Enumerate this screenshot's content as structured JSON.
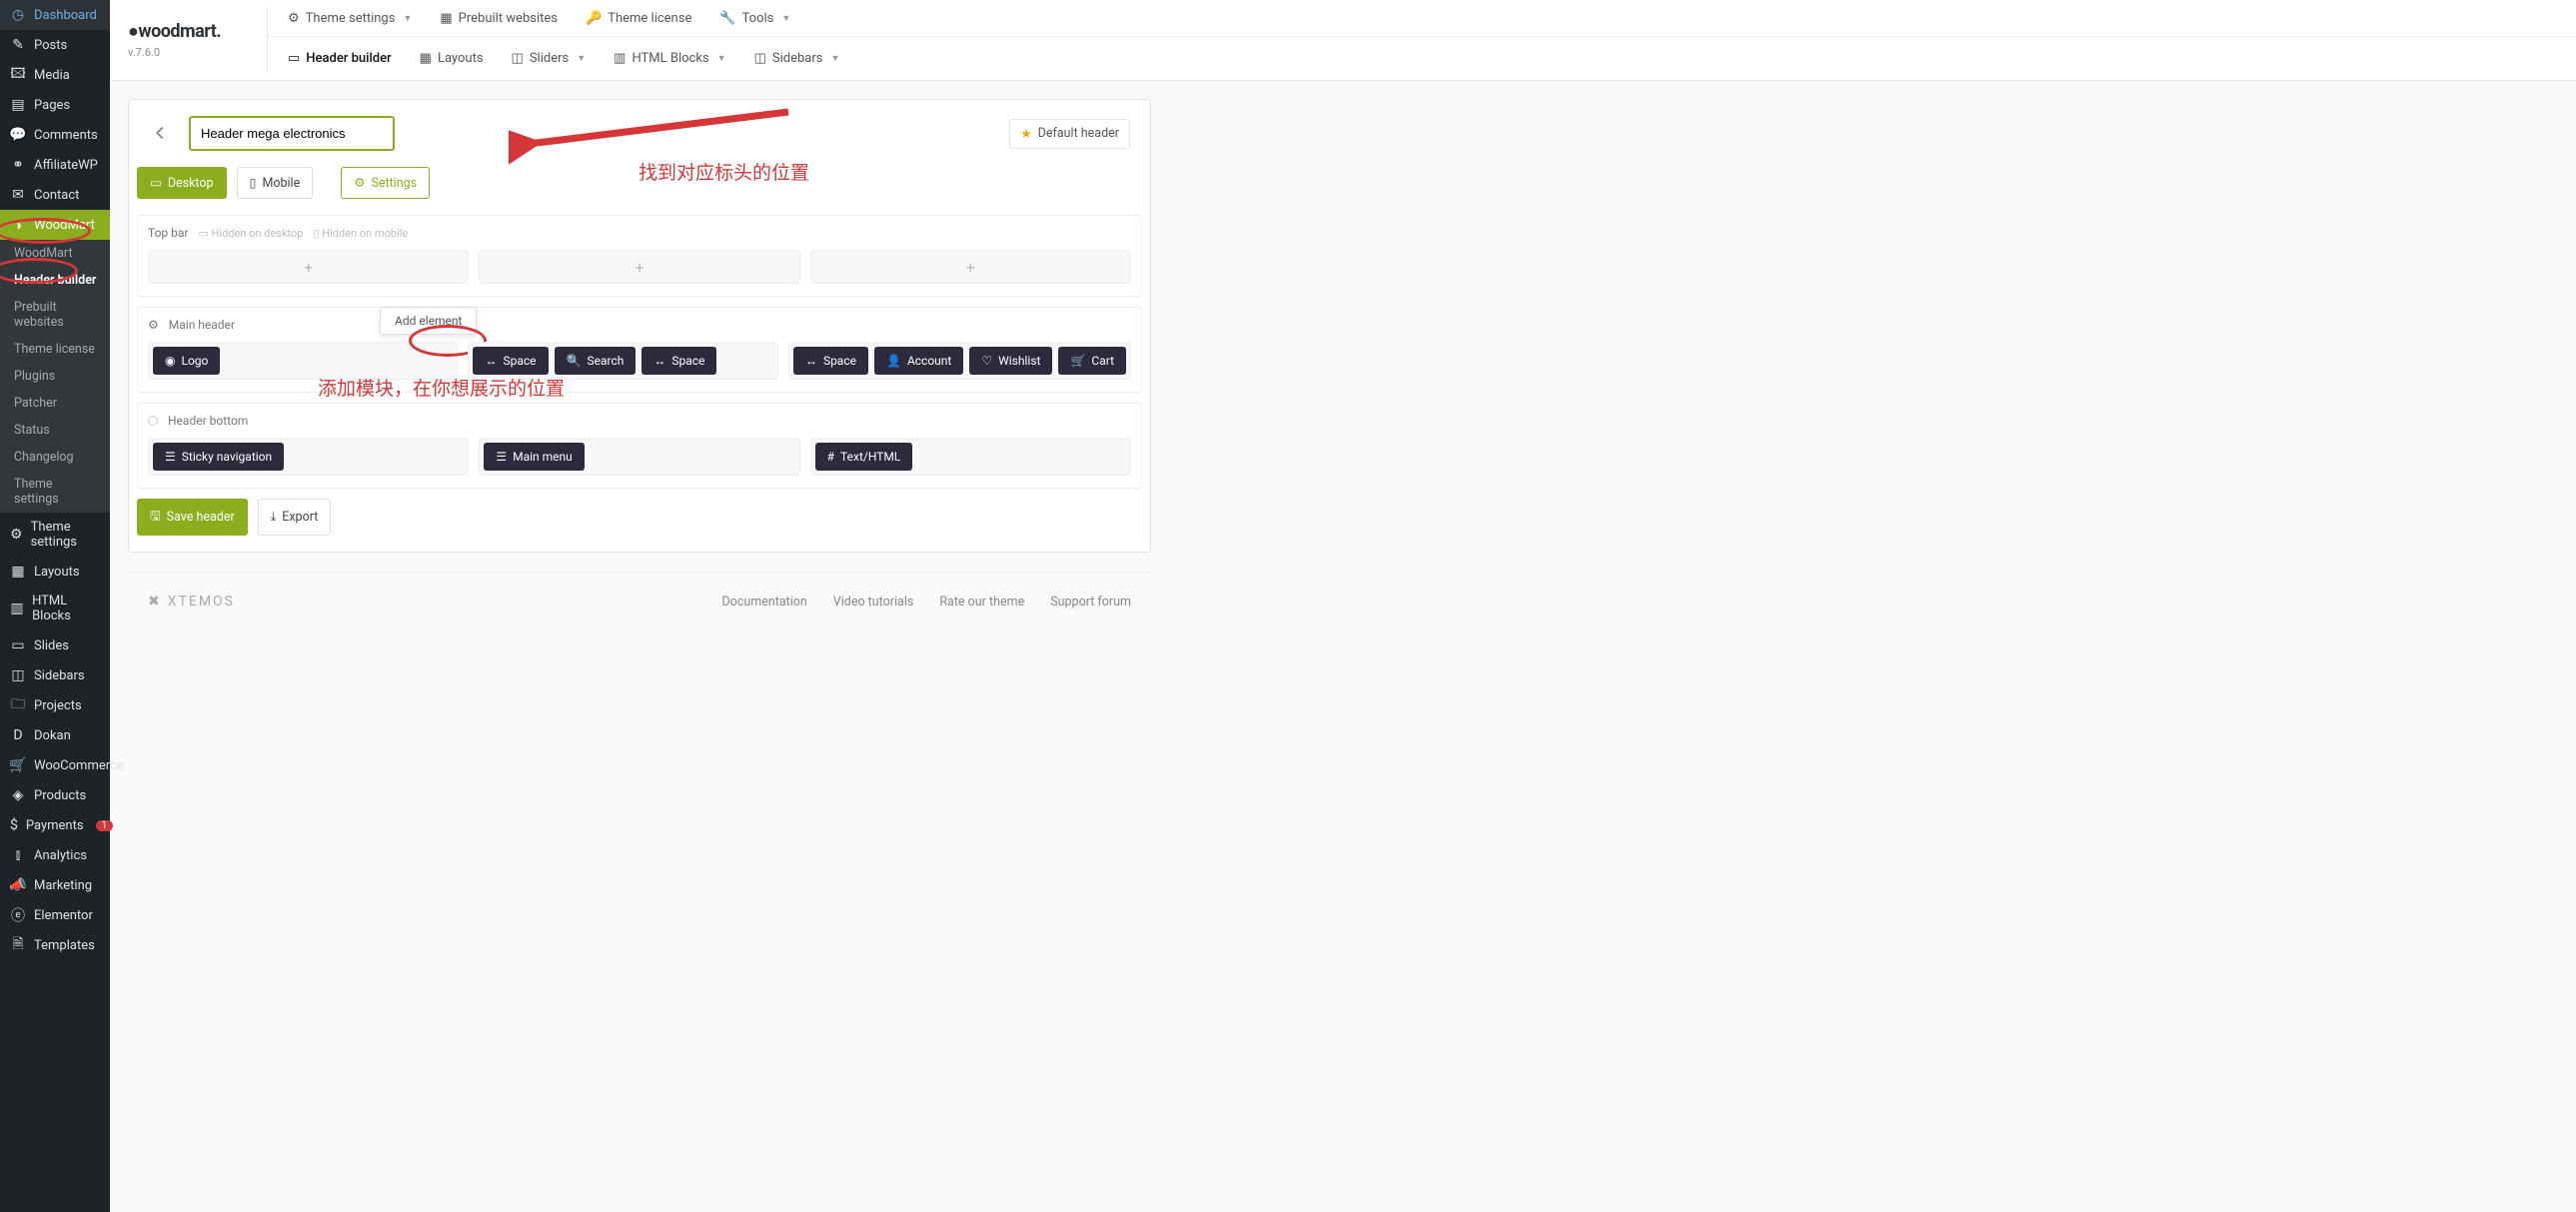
{
  "brand": {
    "name": "woodmart.",
    "version": "v.7.6.0"
  },
  "sidebar": {
    "items": [
      {
        "icon": "◷",
        "label": "Dashboard"
      },
      {
        "icon": "✎",
        "label": "Posts"
      },
      {
        "icon": "🖾",
        "label": "Media"
      },
      {
        "icon": "▤",
        "label": "Pages"
      },
      {
        "icon": "💬",
        "label": "Comments"
      },
      {
        "icon": "⚭",
        "label": "AffiliateWP"
      },
      {
        "icon": "✉",
        "label": "Contact"
      },
      {
        "icon": "◑",
        "label": "WoodMart",
        "active": true
      }
    ],
    "subitems": [
      {
        "label": "WoodMart"
      },
      {
        "label": "Header builder",
        "active": true
      },
      {
        "label": "Prebuilt websites"
      },
      {
        "label": "Theme license"
      },
      {
        "label": "Plugins"
      },
      {
        "label": "Patcher"
      },
      {
        "label": "Status"
      },
      {
        "label": "Changelog"
      },
      {
        "label": "Theme settings"
      }
    ],
    "items2": [
      {
        "icon": "⚙",
        "label": "Theme settings"
      },
      {
        "icon": "▦",
        "label": "Layouts"
      },
      {
        "icon": "▥",
        "label": "HTML Blocks"
      },
      {
        "icon": "▭",
        "label": "Slides"
      },
      {
        "icon": "◫",
        "label": "Sidebars"
      },
      {
        "icon": "🗀",
        "label": "Projects"
      },
      {
        "icon": "D",
        "label": "Dokan"
      },
      {
        "icon": "🛒",
        "label": "WooCommerce"
      },
      {
        "icon": "◈",
        "label": "Products"
      },
      {
        "icon": "$",
        "label": "Payments",
        "badge": "1"
      },
      {
        "icon": "⫾",
        "label": "Analytics"
      },
      {
        "icon": "📣",
        "label": "Marketing"
      },
      {
        "icon": "ⓔ",
        "label": "Elementor"
      },
      {
        "icon": "🗎",
        "label": "Templates"
      }
    ]
  },
  "topnav": [
    {
      "icon": "⚙",
      "label": "Theme settings",
      "chev": true
    },
    {
      "icon": "▦",
      "label": "Prebuilt websites"
    },
    {
      "icon": "🔑",
      "label": "Theme license"
    },
    {
      "icon": "🔧",
      "label": "Tools",
      "chev": true
    }
  ],
  "subnav": [
    {
      "icon": "▭",
      "label": "Header builder",
      "active": true
    },
    {
      "icon": "▦",
      "label": "Layouts"
    },
    {
      "icon": "◫",
      "label": "Sliders",
      "chev": true
    },
    {
      "icon": "▥",
      "label": "HTML Blocks",
      "chev": true
    },
    {
      "icon": "◫",
      "label": "Sidebars",
      "chev": true
    }
  ],
  "header": {
    "title_input": "Header mega electronics",
    "default_label": "Default header"
  },
  "viewbar": {
    "desktop": "Desktop",
    "mobile": "Mobile",
    "settings": "Settings"
  },
  "rows": {
    "topbar": {
      "label": "Top bar",
      "tags": [
        "Hidden on desktop",
        "Hidden on mobile"
      ]
    },
    "main": {
      "label": "Main header",
      "tooltip": "Add element",
      "col1": [
        {
          "icon": "◉",
          "label": "Logo"
        }
      ],
      "col2": [
        {
          "icon": "↔",
          "label": "Space"
        },
        {
          "icon": "🔍",
          "label": "Search"
        },
        {
          "icon": "↔",
          "label": "Space"
        }
      ],
      "col3": [
        {
          "icon": "↔",
          "label": "Space"
        },
        {
          "icon": "👤",
          "label": "Account"
        },
        {
          "icon": "♡",
          "label": "Wishlist"
        },
        {
          "icon": "🛒",
          "label": "Cart"
        }
      ]
    },
    "bottom": {
      "label": "Header bottom",
      "col1": [
        {
          "icon": "☰",
          "label": "Sticky navigation"
        }
      ],
      "col2": [
        {
          "icon": "☰",
          "label": "Main menu"
        }
      ],
      "col3": [
        {
          "icon": "#",
          "label": "Text/HTML"
        }
      ]
    }
  },
  "actions": {
    "save": "Save header",
    "export": "Export"
  },
  "annotations": {
    "a1": "找到对应标头的位置",
    "a2": "添加模块，在你想展示的位置"
  },
  "footer": {
    "brand": "XTEMOS",
    "links": [
      "Documentation",
      "Video tutorials",
      "Rate our theme",
      "Support forum"
    ]
  }
}
